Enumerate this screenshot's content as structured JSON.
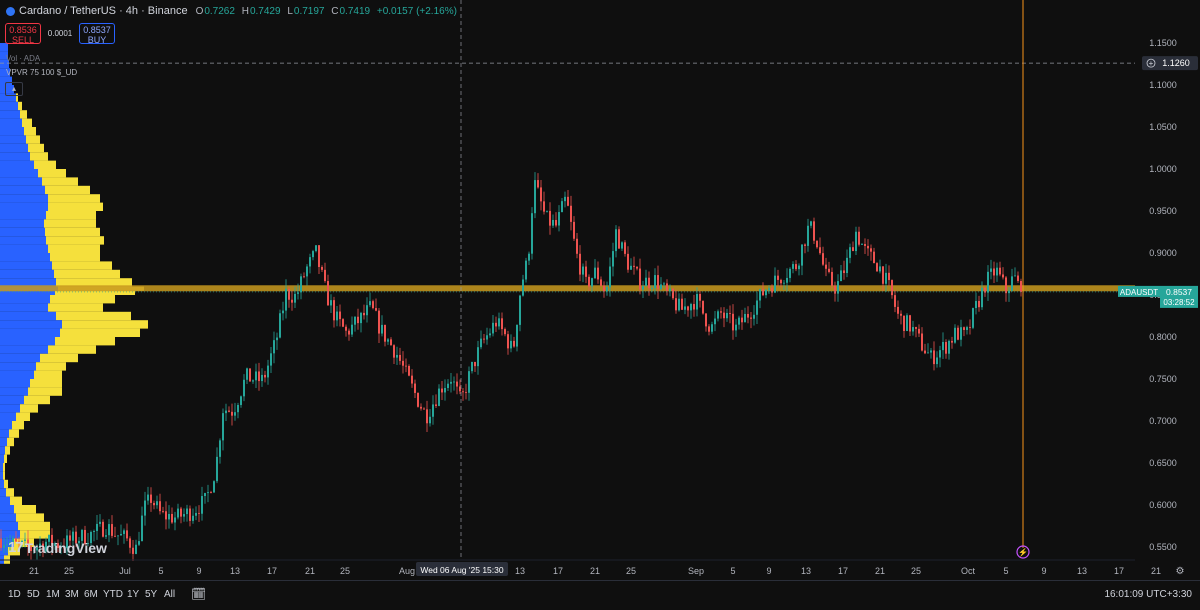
{
  "header": {
    "title": "Cardano / TetherUS · 4h · Binance",
    "ohlc": [
      {
        "label": "O",
        "value": "0.7262"
      },
      {
        "label": "H",
        "value": "0.7429"
      },
      {
        "label": "L",
        "value": "0.7197"
      },
      {
        "label": "C",
        "value": "0.7419"
      }
    ],
    "change": "+0.0157 (+2.16%)"
  },
  "trade": {
    "sell_price": "0.8536",
    "sell_label": "SELL",
    "spread": "0.0001",
    "buy_price": "0.8537",
    "buy_label": "BUY"
  },
  "indicators": {
    "volume": "Vol · ADA",
    "vpvr": "VPVR 75 100 $_UD"
  },
  "logo": {
    "text": "TradingView"
  },
  "timeframes": [
    "1D",
    "5D",
    "1M",
    "3M",
    "6M",
    "YTD",
    "1Y",
    "5Y",
    "All"
  ],
  "clock": "16:01:09 UTC+3:30",
  "colors": {
    "background": "#0f0f0f",
    "up": "#26a69a",
    "down": "#ef5350",
    "poc_line": "#c99a1e",
    "crosshair_v": "#f7931a",
    "vp_up": "#2962ff",
    "vp_down": "#f5e03c",
    "price_label": "#26a69a"
  },
  "chart_data": {
    "type": "candlestick",
    "symbol": "ADAUSDT",
    "ylim": [
      0.535,
      1.165
    ],
    "y_ticks": [
      "1.1500",
      "1.1000",
      "1.0500",
      "1.0000",
      "0.9500",
      "0.9000",
      "0.8500",
      "0.8000",
      "0.7500",
      "0.7000",
      "0.6500",
      "0.6000",
      "0.5500"
    ],
    "x_ticks": [
      "21",
      "25",
      "Jul",
      "5",
      "9",
      "13",
      "17",
      "21",
      "25",
      "Aug",
      "5",
      "9",
      "13",
      "17",
      "21",
      "25",
      "Sep",
      "5",
      "9",
      "13",
      "17",
      "21",
      "25",
      "Oct",
      "5",
      "9",
      "13",
      "17",
      "21"
    ],
    "crosshair_price": "1.1260",
    "crosshair_time": "Wed 06 Aug '25   15:30",
    "current_price": "0.8537",
    "current_countdown": "03:28:52",
    "poc_price": 0.858,
    "approx_closes": [
      [
        0,
        0.56
      ],
      [
        15,
        0.552
      ],
      [
        30,
        0.548
      ],
      [
        45,
        0.556
      ],
      [
        60,
        0.553
      ],
      [
        75,
        0.56
      ],
      [
        90,
        0.565
      ],
      [
        105,
        0.575
      ],
      [
        115,
        0.565
      ],
      [
        125,
        0.56
      ],
      [
        135,
        0.548
      ],
      [
        143,
        0.595
      ],
      [
        150,
        0.608
      ],
      [
        160,
        0.588
      ],
      [
        175,
        0.585
      ],
      [
        190,
        0.592
      ],
      [
        205,
        0.605
      ],
      [
        215,
        0.645
      ],
      [
        222,
        0.715
      ],
      [
        232,
        0.712
      ],
      [
        245,
        0.752
      ],
      [
        262,
        0.748
      ],
      [
        275,
        0.795
      ],
      [
        285,
        0.852
      ],
      [
        295,
        0.848
      ],
      [
        305,
        0.88
      ],
      [
        315,
        0.9
      ],
      [
        325,
        0.852
      ],
      [
        335,
        0.822
      ],
      [
        345,
        0.805
      ],
      [
        360,
        0.822
      ],
      [
        370,
        0.835
      ],
      [
        380,
        0.808
      ],
      [
        395,
        0.782
      ],
      [
        410,
        0.742
      ],
      [
        425,
        0.706
      ],
      [
        440,
        0.74
      ],
      [
        450,
        0.752
      ],
      [
        460,
        0.722
      ],
      [
        470,
        0.76
      ],
      [
        480,
        0.79
      ],
      [
        495,
        0.818
      ],
      [
        505,
        0.8
      ],
      [
        512,
        0.782
      ],
      [
        520,
        0.862
      ],
      [
        527,
        0.892
      ],
      [
        533,
        0.985
      ],
      [
        545,
        0.94
      ],
      [
        555,
        0.932
      ],
      [
        565,
        0.965
      ],
      [
        575,
        0.9
      ],
      [
        585,
        0.862
      ],
      [
        595,
        0.878
      ],
      [
        605,
        0.852
      ],
      [
        615,
        0.925
      ],
      [
        625,
        0.892
      ],
      [
        632,
        0.878
      ],
      [
        640,
        0.865
      ],
      [
        655,
        0.868
      ],
      [
        665,
        0.852
      ],
      [
        680,
        0.832
      ],
      [
        695,
        0.845
      ],
      [
        710,
        0.81
      ],
      [
        720,
        0.828
      ],
      [
        735,
        0.81
      ],
      [
        750,
        0.832
      ],
      [
        765,
        0.858
      ],
      [
        780,
        0.872
      ],
      [
        795,
        0.885
      ],
      [
        808,
        0.932
      ],
      [
        815,
        0.918
      ],
      [
        825,
        0.872
      ],
      [
        835,
        0.858
      ],
      [
        845,
        0.885
      ],
      [
        855,
        0.925
      ],
      [
        865,
        0.9
      ],
      [
        878,
        0.885
      ],
      [
        888,
        0.858
      ],
      [
        898,
        0.822
      ],
      [
        910,
        0.812
      ],
      [
        920,
        0.792
      ],
      [
        930,
        0.775
      ],
      [
        945,
        0.79
      ],
      [
        955,
        0.805
      ],
      [
        965,
        0.8
      ],
      [
        975,
        0.835
      ],
      [
        985,
        0.865
      ],
      [
        995,
        0.88
      ],
      [
        1005,
        0.855
      ],
      [
        1013,
        0.872
      ],
      [
        1020,
        0.8537
      ]
    ],
    "volume_profile": [
      [
        1.15,
        8,
        0
      ],
      [
        1.14,
        8,
        0
      ],
      [
        1.13,
        9,
        0
      ],
      [
        1.12,
        10,
        0
      ],
      [
        1.11,
        12,
        0
      ],
      [
        1.1,
        14,
        0
      ],
      [
        1.09,
        16,
        2
      ],
      [
        1.08,
        18,
        4
      ],
      [
        1.07,
        20,
        7
      ],
      [
        1.06,
        22,
        10
      ],
      [
        1.05,
        24,
        12
      ],
      [
        1.04,
        26,
        14
      ],
      [
        1.03,
        28,
        16
      ],
      [
        1.02,
        30,
        18
      ],
      [
        1.01,
        34,
        22
      ],
      [
        1.0,
        38,
        28
      ],
      [
        0.99,
        42,
        36
      ],
      [
        0.98,
        45,
        45
      ],
      [
        0.97,
        48,
        52
      ],
      [
        0.96,
        48,
        55
      ],
      [
        0.95,
        46,
        50
      ],
      [
        0.94,
        44,
        52
      ],
      [
        0.93,
        45,
        55
      ],
      [
        0.92,
        46,
        58
      ],
      [
        0.91,
        48,
        52
      ],
      [
        0.9,
        50,
        50
      ],
      [
        0.89,
        52,
        60
      ],
      [
        0.88,
        54,
        66
      ],
      [
        0.87,
        56,
        76
      ],
      [
        0.86,
        58,
        86
      ],
      [
        0.855,
        55,
        80
      ],
      [
        0.85,
        50,
        65
      ],
      [
        0.84,
        48,
        55
      ],
      [
        0.83,
        56,
        75
      ],
      [
        0.82,
        62,
        86
      ],
      [
        0.81,
        60,
        80
      ],
      [
        0.8,
        55,
        60
      ],
      [
        0.79,
        48,
        48
      ],
      [
        0.78,
        40,
        38
      ],
      [
        0.77,
        36,
        30
      ],
      [
        0.76,
        34,
        28
      ],
      [
        0.75,
        30,
        32
      ],
      [
        0.74,
        28,
        34
      ],
      [
        0.73,
        24,
        26
      ],
      [
        0.72,
        20,
        18
      ],
      [
        0.71,
        16,
        14
      ],
      [
        0.7,
        12,
        12
      ],
      [
        0.69,
        9,
        10
      ],
      [
        0.68,
        7,
        7
      ],
      [
        0.67,
        5,
        5
      ],
      [
        0.66,
        4,
        3
      ],
      [
        0.65,
        3,
        2
      ],
      [
        0.64,
        3,
        2
      ],
      [
        0.63,
        4,
        4
      ],
      [
        0.62,
        6,
        8
      ],
      [
        0.61,
        10,
        12
      ],
      [
        0.6,
        14,
        22
      ],
      [
        0.59,
        16,
        28
      ],
      [
        0.58,
        18,
        32
      ],
      [
        0.57,
        20,
        30
      ],
      [
        0.56,
        14,
        20
      ],
      [
        0.55,
        8,
        12
      ],
      [
        0.54,
        4,
        6
      ]
    ]
  }
}
